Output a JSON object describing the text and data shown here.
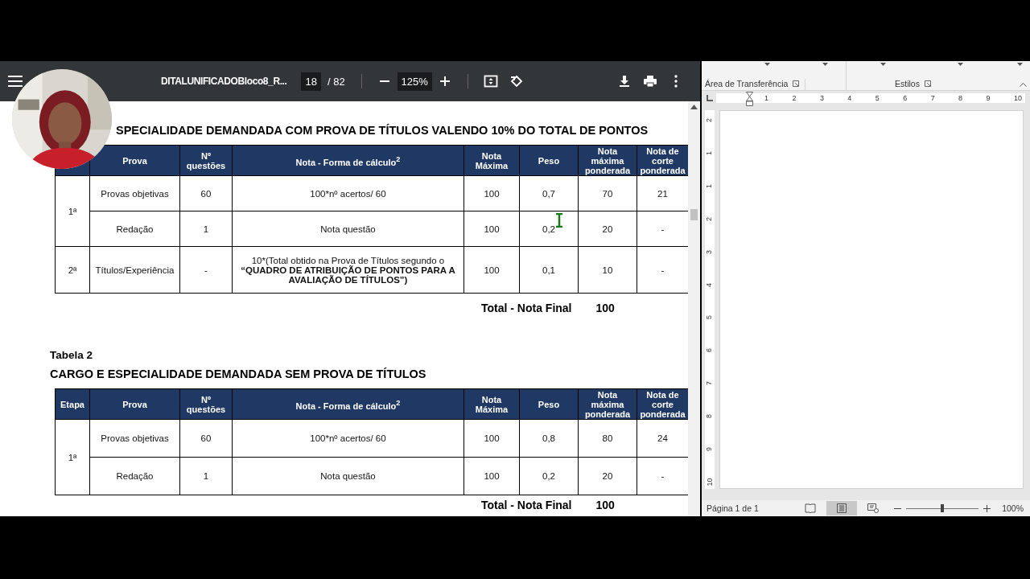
{
  "pdf_viewer": {
    "title": "DITALUNIFICADOBloco8_R...",
    "page": "18",
    "page_count": "/ 82",
    "zoom": "125%"
  },
  "document": {
    "heading_1": "SPECIALIDADE DEMANDADA COM PROVA DE TÍTULOS VALENDO 10% DO TOTAL DE PONTOS",
    "table_1": {
      "columns": [
        "Prova",
        "Nº questões",
        "Nota - Forma de cálculo$^{2}$",
        "Nota Máxima",
        "Peso",
        "Nota máxima ponderada",
        "Nota de corte ponderada"
      ],
      "groups": [
        {
          "etapa": "1ª",
          "rows": [
            [
              "Provas objetivas",
              "60",
              "100*nº acertos/ 60",
              "100",
              "0,7",
              "70",
              "21"
            ],
            [
              "Redação",
              "1",
              "Nota questão",
              "100",
              "0,2",
              "20",
              "-"
            ]
          ]
        },
        {
          "etapa": "2ª",
          "rows": [
            [
              "Títulos/Experiência",
              "-",
              "10*(Total obtido na Prova de Títulos segundo o **“QUADRO DE ATRIBUIÇÃO DE PONTOS PARA A AVALIAÇÃO DE TÍTULOS”)**",
              "100",
              "0,1",
              "10",
              "-"
            ]
          ]
        }
      ]
    },
    "total_1": {
      "label": "Total - Nota Final",
      "value": "100"
    },
    "caption_2": "Tabela 2",
    "heading_2": "CARGO E ESPECIALIDADE DEMANDADA SEM PROVA DE TÍTULOS",
    "table_2": {
      "columns": [
        "Etapa",
        "Prova",
        "Nº questões",
        "Nota - Forma de cálculo$^{2}$",
        "Nota Máxima",
        "Peso",
        "Nota máxima ponderada",
        "Nota de corte ponderada"
      ],
      "groups": [
        {
          "etapa": "1ª",
          "rows": [
            [
              "Provas objetivas",
              "60",
              "100*nº acertos/ 60",
              "100",
              "0,8",
              "80",
              "24"
            ],
            [
              "Redação",
              "1",
              "Nota questão",
              "100",
              "0,2",
              "20",
              "-"
            ]
          ]
        }
      ]
    },
    "total_2": {
      "label": "Total - Nota Final",
      "value": "100"
    }
  },
  "word": {
    "ribbon_groups": [
      "Área de Transferência",
      "Estilos"
    ],
    "ruler": [
      "1",
      "2",
      "3",
      "4",
      "5",
      "6",
      "7",
      "8",
      "9",
      "10"
    ],
    "vertical_ruler": [
      "2",
      "1",
      "1",
      "2",
      "3",
      "4",
      "5",
      "6",
      "7",
      "8",
      "9",
      "10"
    ],
    "status": "Página 1 de 1",
    "zoom": {
      "level": 0.5,
      "reading": "100%"
    }
  }
}
